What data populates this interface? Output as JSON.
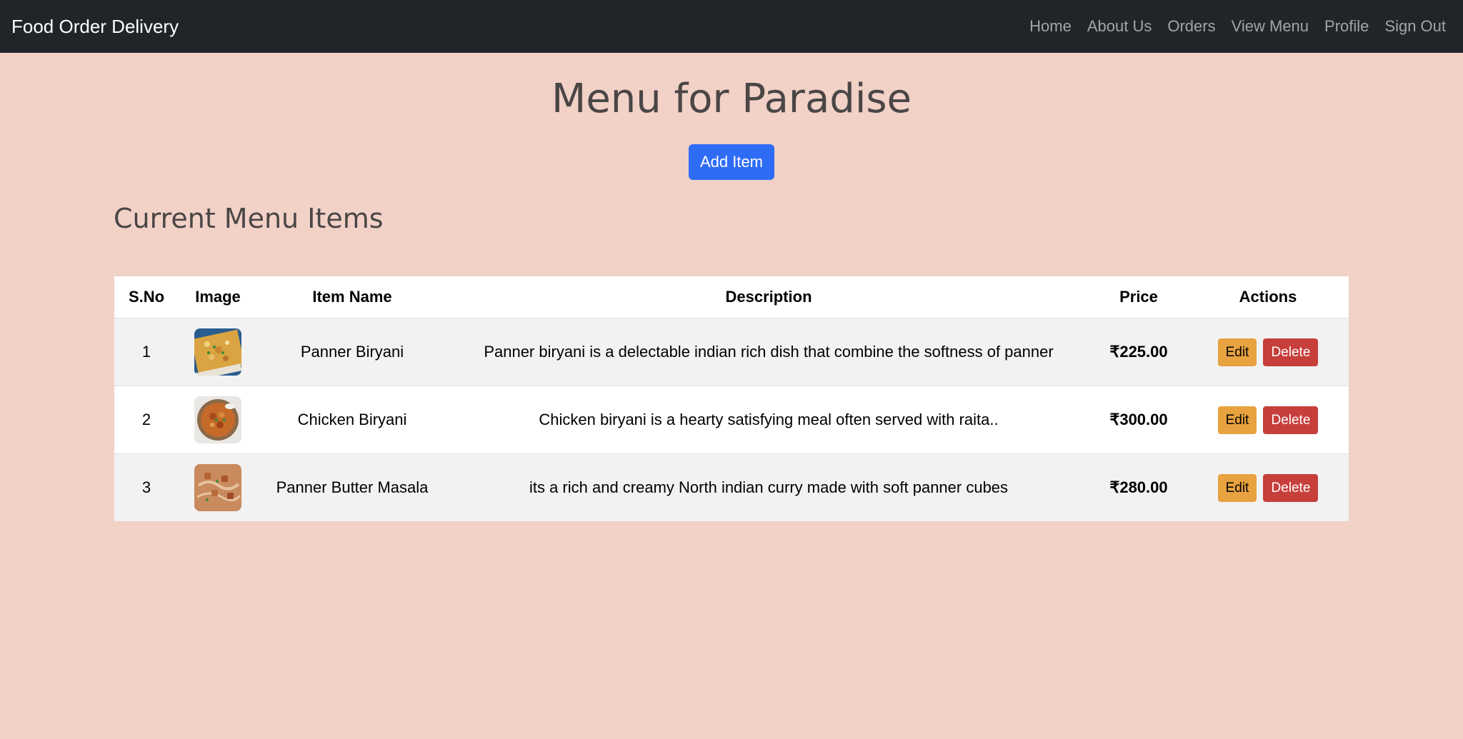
{
  "navbar": {
    "brand": "Food Order Delivery",
    "links": [
      "Home",
      "About Us",
      "Orders",
      "View Menu",
      "Profile",
      "Sign Out"
    ]
  },
  "page": {
    "title": "Menu for Paradise",
    "add_button": "Add Item",
    "section_title": "Current Menu Items"
  },
  "table": {
    "headers": [
      "S.No",
      "Image",
      "Item Name",
      "Description",
      "Price",
      "Actions"
    ],
    "rows": [
      {
        "sno": "1",
        "image_icon": "panner-biryani-photo",
        "name": "Panner Biryani",
        "description": "Panner biryani is a delectable indian rich dish that combine the softness of panner",
        "price": "₹225.00",
        "edit_label": "Edit",
        "delete_label": "Delete"
      },
      {
        "sno": "2",
        "image_icon": "chicken-biryani-photo",
        "name": "Chicken Biryani",
        "description": "Chicken biryani is a hearty satisfying meal often served with raita..",
        "price": "₹300.00",
        "edit_label": "Edit",
        "delete_label": "Delete"
      },
      {
        "sno": "3",
        "image_icon": "panner-butter-masala-photo",
        "name": "Panner Butter Masala",
        "description": "its a rich and creamy North indian curry made with soft panner cubes",
        "price": "₹280.00",
        "edit_label": "Edit",
        "delete_label": "Delete"
      }
    ]
  },
  "colors": {
    "background": "#f2d1c7",
    "navbar": "#212529",
    "primary": "#2f6cf6",
    "warning": "#e8a23f",
    "danger": "#c63f3b"
  }
}
